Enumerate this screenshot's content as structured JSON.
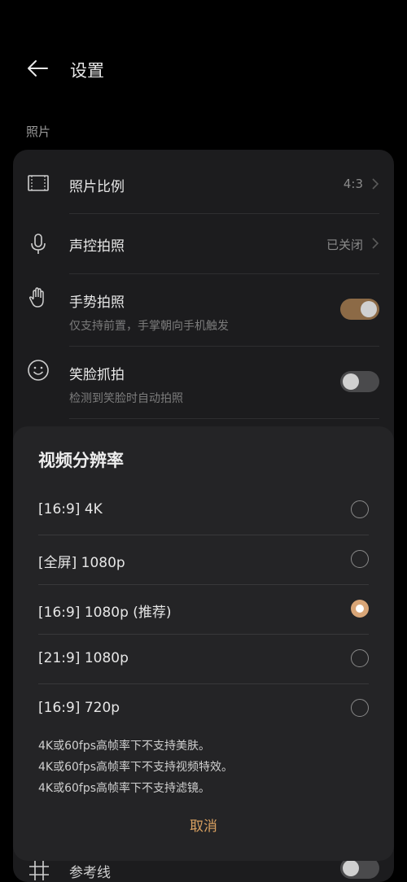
{
  "header": {
    "title": "设置"
  },
  "section": {
    "photo": "照片"
  },
  "rows": {
    "ratio": {
      "label": "照片比例",
      "value": "4:3"
    },
    "voice": {
      "label": "声控拍照",
      "value": "已关闭"
    },
    "gesture": {
      "label": "手势拍照",
      "sub": "仅支持前置，手掌朝向手机触发",
      "on": true
    },
    "smile": {
      "label": "笑脸抓拍",
      "sub": "检测到笑脸时自动拍照",
      "on": false
    },
    "grid": {
      "label": "参考线",
      "on": false
    }
  },
  "sheet": {
    "title": "视频分辨率",
    "options": [
      {
        "label": "[16:9] 4K",
        "selected": false
      },
      {
        "label": "[全屏] 1080p",
        "selected": false
      },
      {
        "label": "[16:9] 1080p (推荐)",
        "selected": true
      },
      {
        "label": "[21:9] 1080p",
        "selected": false
      },
      {
        "label": "[16:9] 720p",
        "selected": false
      }
    ],
    "notes": [
      "4K或60fps高帧率下不支持美肤。",
      "4K或60fps高帧率下不支持视频特效。",
      "4K或60fps高帧率下不支持滤镜。"
    ],
    "cancel": "取消"
  },
  "colors": {
    "accent": "#d8a577",
    "toggle_on": "#8c6a46",
    "sheet_bg": "#242426",
    "card_bg": "#1c1c1e"
  }
}
